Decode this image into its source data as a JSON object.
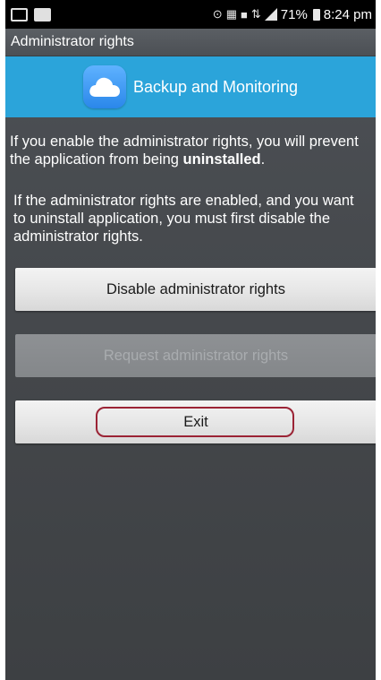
{
  "status_bar": {
    "icons_left": [
      "gallery-icon",
      "photo-icon"
    ],
    "icons_right": [
      "alarm-icon",
      "volte-icon",
      "nfc-icon",
      "lte-icon",
      "signal-icon"
    ],
    "battery": "71%",
    "time": "8:24 pm"
  },
  "title_bar": {
    "title": "Administrator rights"
  },
  "banner": {
    "app_name": "Backup and Monitoring",
    "icon": "cloud-icon",
    "color": "#2ba4da"
  },
  "content": {
    "para1_pre": "If you enable the administrator rights, you will prevent the application from being ",
    "para1_bold": "uninstalled",
    "para1_post": ".",
    "para2": "If the administrator rights are enabled, and you want to uninstall application, you must first disable the administrator rights."
  },
  "buttons": {
    "disable": "Disable administrator rights",
    "request": "Request administrator rights",
    "exit": "Exit"
  },
  "highlight_color": "#9b2335"
}
